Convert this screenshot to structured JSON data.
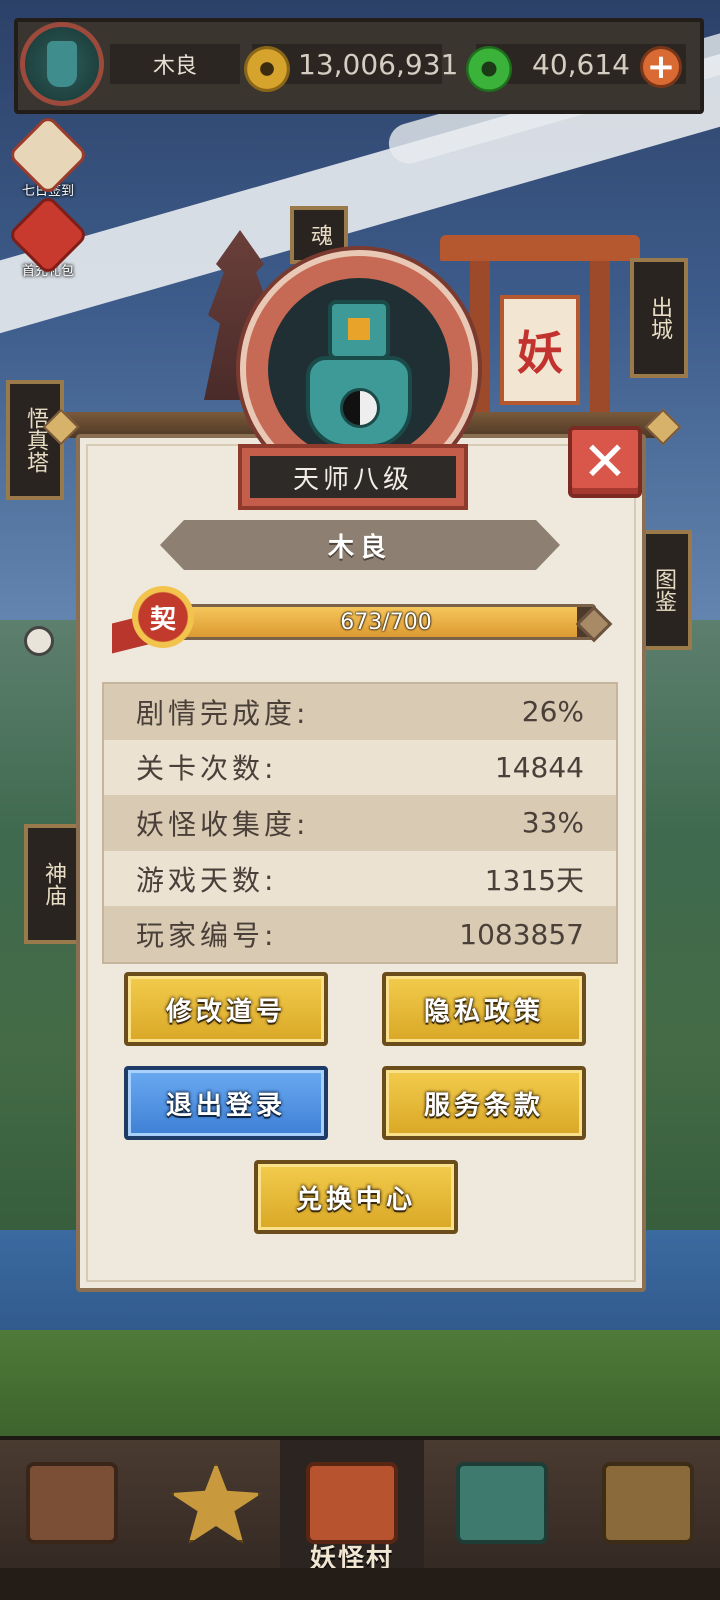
{
  "topbar": {
    "player_name": "木良",
    "gold_amount": "13,006,931",
    "jade_amount": "40,614",
    "plus_symbol": "+"
  },
  "events": [
    {
      "label": "七日签到",
      "icon": "scroll-clock-icon"
    },
    {
      "label": "首充礼包",
      "icon": "gift-box-icon"
    }
  ],
  "scene_signs": {
    "soul": "魂",
    "exit_city": "出城",
    "wukong_tower": "悟真塔",
    "codex": "图鉴",
    "temple": "神庙",
    "demon_plaque": "妖"
  },
  "profile": {
    "rank": "天师八级",
    "name": "木良",
    "pact_badge": "契",
    "progress_text": "673/700",
    "progress_current": 673,
    "progress_max": 700,
    "close_symbol": "✕"
  },
  "stats": [
    {
      "label": "剧情完成度:",
      "value": "26%"
    },
    {
      "label": "关卡次数:",
      "value": "14844"
    },
    {
      "label": "妖怪收集度:",
      "value": "33%"
    },
    {
      "label": "游戏天数:",
      "value": "1315天"
    },
    {
      "label": "玩家编号:",
      "value": "1083857"
    }
  ],
  "buttons": {
    "edit_name": "修改道号",
    "privacy": "隐私政策",
    "logout": "退出登录",
    "terms": "服务条款",
    "redeem": "兑换中心"
  },
  "bottom_nav": {
    "active_label": "妖怪村",
    "items": [
      "treasure-chest-icon",
      "star-altar-icon",
      "demon-village-icon",
      "market-icon",
      "spellbook-icon"
    ]
  },
  "colors": {
    "gold_button": "#f3cc4d",
    "blue_button": "#6aaaf2",
    "close_button": "#d8574a",
    "modal_bg": "#efe8dc"
  }
}
